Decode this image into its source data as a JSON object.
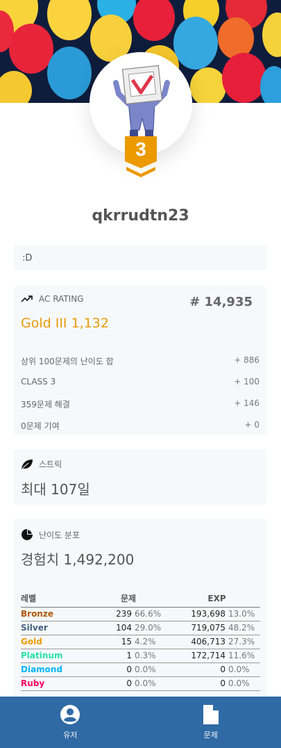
{
  "profile": {
    "handle": "qkrrudtn23",
    "tier_number": "3",
    "bio": ":D"
  },
  "rating_card": {
    "title": "AC RATING",
    "rank": "# 14,935",
    "rating": "Gold III 1,132",
    "rating_color": "#e89a0c",
    "breakdown": [
      {
        "label": "상위 100문제의 난이도 합",
        "value": "+ 886"
      },
      {
        "label": "CLASS 3",
        "value": "+ 100"
      },
      {
        "label": "359문제 해결",
        "value": "+ 146"
      },
      {
        "label": "0문제 기여",
        "value": "+ 0"
      }
    ]
  },
  "streak_card": {
    "title": "스트릭",
    "value": "최대 107일"
  },
  "distribution_card": {
    "title": "난이도 분포",
    "exp": "경험치 1,492,200",
    "headers": {
      "level": "레벨",
      "problems": "문제",
      "exp": "EXP"
    },
    "rows": [
      {
        "tier": "Bronze",
        "color": "#ad5600",
        "count": "239",
        "count_pct": "66.6%",
        "exp": "193,698",
        "exp_pct": "13.0%"
      },
      {
        "tier": "Silver",
        "color": "#435f7a",
        "count": "104",
        "count_pct": "29.0%",
        "exp": "719,075",
        "exp_pct": "48.2%"
      },
      {
        "tier": "Gold",
        "color": "#ec9a00",
        "count": "15",
        "count_pct": "4.2%",
        "exp": "406,713",
        "exp_pct": "27.3%"
      },
      {
        "tier": "Platinum",
        "color": "#27e2a4",
        "count": "1",
        "count_pct": "0.3%",
        "exp": "172,714",
        "exp_pct": "11.6%"
      },
      {
        "tier": "Diamond",
        "color": "#00b4fc",
        "count": "0",
        "count_pct": "0.0%",
        "exp": "0",
        "exp_pct": "0.0%"
      },
      {
        "tier": "Ruby",
        "color": "#ff0062",
        "count": "0",
        "count_pct": "0.0%",
        "exp": "0",
        "exp_pct": "0.0%"
      }
    ]
  },
  "bottom_nav": {
    "items": [
      {
        "label": "유저",
        "icon": "user-circle-icon"
      },
      {
        "label": "문제",
        "icon": "document-icon"
      }
    ]
  }
}
